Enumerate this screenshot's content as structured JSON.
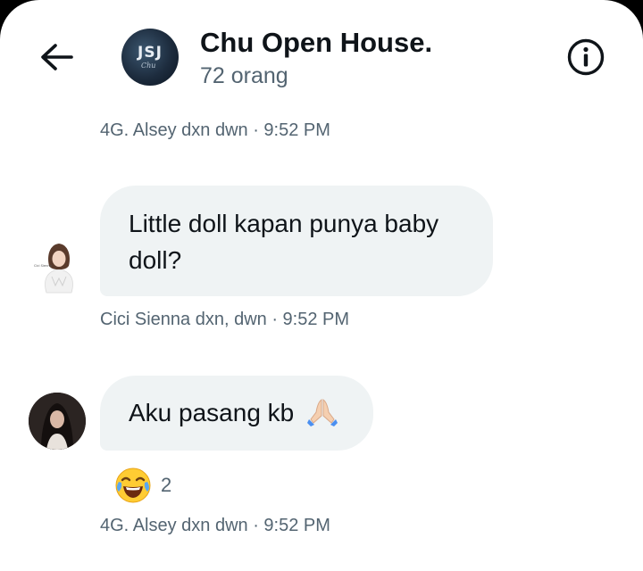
{
  "header": {
    "back_icon": "arrow-left-icon",
    "avatar_text": "JSJ",
    "avatar_sub": "Chu",
    "title": "Chu Open House.",
    "member_count": "72 orang",
    "info_icon": "info-circle-icon"
  },
  "messages": [
    {
      "type": "meta",
      "text": "4G. Alsey dxn dwn · 9:52 PM"
    },
    {
      "type": "bubble",
      "lines": [
        "Little doll kapan punya baby",
        "doll?"
      ],
      "meta": "Cici Sienna dxn, dwn · 9:52 PM",
      "avatar_caption": "Cici Sienna"
    },
    {
      "type": "bubble",
      "text": "Aku pasang kb",
      "emoji": "folded-hands-icon",
      "reaction": {
        "emoji": "face-with-tears-of-joy-icon",
        "count": "2"
      },
      "meta": "4G. Alsey dxn dwn · 9:52 PM"
    }
  ],
  "colors": {
    "bubble": "#eff3f4",
    "meta": "#536471",
    "text": "#0f1419"
  }
}
